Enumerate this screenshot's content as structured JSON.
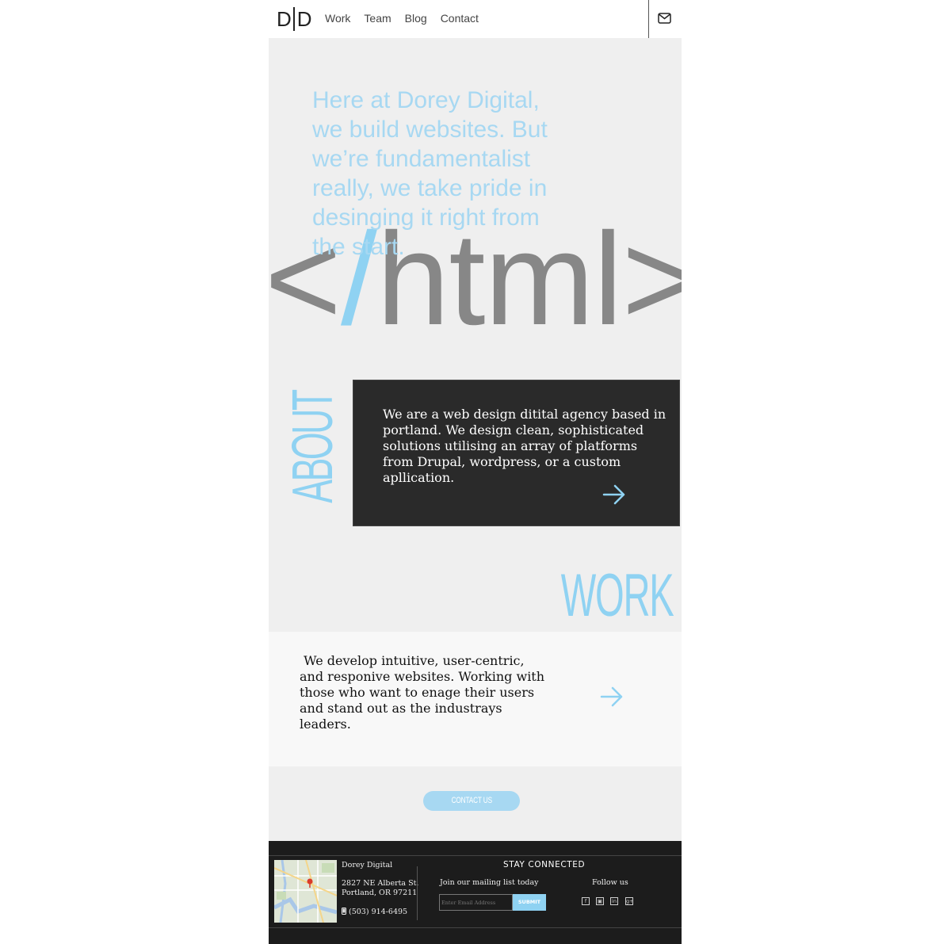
{
  "header": {
    "logo_text": "D|D",
    "nav": [
      "Work",
      "Team",
      "Blog",
      "Contact"
    ],
    "mail_icon": "envelope-icon"
  },
  "hero": {
    "intro": "Here at Dorey Digital, we build websites. But we’re fundamentalist really, we take pride in desinging it right from the start.",
    "tag_open": "<",
    "tag_slash": "/",
    "tag_rest": "html>"
  },
  "about": {
    "heading": "ABOUT",
    "body": "We are a web design ditital agency based in portland. We design clean, sophisticated solutions utilising an array of platforms from Drupal, wordpress, or a custom apllication.",
    "arrow_icon": "arrow-right-icon"
  },
  "work": {
    "heading": "WORK",
    "body": " We develop intuitive, user-centric, and responive websites. Working with those who want to enage their users and stand out as the industrays leaders.",
    "arrow_icon": "arrow-right-icon"
  },
  "contact": {
    "button_label": "CONTACT US"
  },
  "footer": {
    "company": "Dorey Digital",
    "street": "2827 NE Alberta St.",
    "city": "Portland, OR 97211",
    "phone": "(503) 914-6495",
    "stay_connected": "STAY  CONNECTED",
    "mailing_list": "Join our mailing list today",
    "email_placeholder": "Enter Email Address",
    "submit_label": "SUBMIT",
    "follow_us": "Follow us",
    "social": [
      "facebook-icon",
      "instagram-icon",
      "linkedin-icon",
      "google-plus-icon"
    ]
  },
  "colors": {
    "accent": "#8fd2f2",
    "hero_text": "#a7d8f2",
    "tag_gray": "#878787",
    "dark_card": "#2a2a2a",
    "footer_bg": "#1c1c1c",
    "page_bg": "#efefef"
  }
}
